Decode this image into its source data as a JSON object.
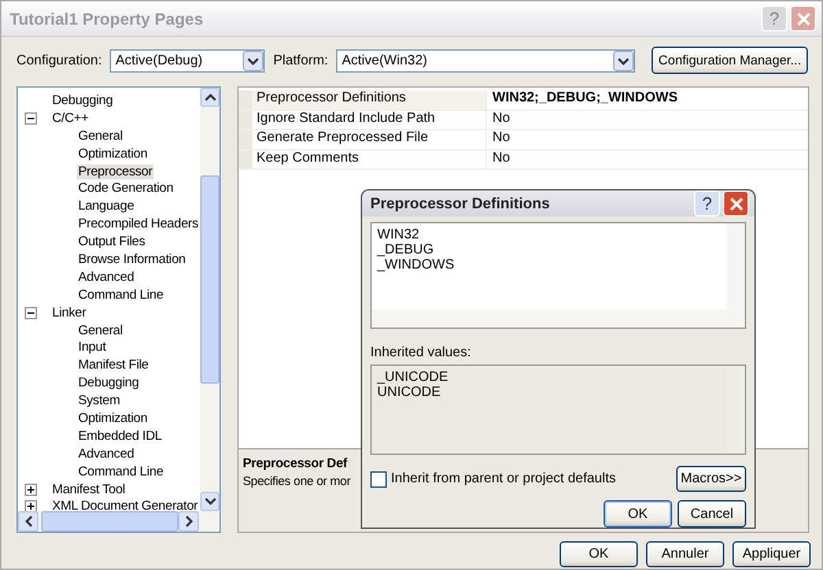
{
  "window": {
    "title": "Tutorial1 Property Pages",
    "help": "?"
  },
  "configuration": {
    "label": "Configuration:",
    "value": "Active(Debug)"
  },
  "platform": {
    "label": "Platform:",
    "value": "Active(Win32)"
  },
  "config_manager_button": "Configuration Manager...",
  "tree": [
    {
      "label": "Debugging",
      "selected": false
    },
    {
      "label": "C/C++",
      "selected": false,
      "expanded": true,
      "children": [
        {
          "label": "General",
          "selected": false
        },
        {
          "label": "Optimization",
          "selected": false
        },
        {
          "label": "Preprocessor",
          "selected": true
        },
        {
          "label": "Code Generation",
          "selected": false
        },
        {
          "label": "Language",
          "selected": false
        },
        {
          "label": "Precompiled Headers",
          "selected": false
        },
        {
          "label": "Output Files",
          "selected": false
        },
        {
          "label": "Browse Information",
          "selected": false
        },
        {
          "label": "Advanced",
          "selected": false
        },
        {
          "label": "Command Line",
          "selected": false
        }
      ]
    },
    {
      "label": "Linker",
      "selected": false,
      "expanded": true,
      "children": [
        {
          "label": "General",
          "selected": false
        },
        {
          "label": "Input",
          "selected": false
        },
        {
          "label": "Manifest File",
          "selected": false
        },
        {
          "label": "Debugging",
          "selected": false
        },
        {
          "label": "System",
          "selected": false
        },
        {
          "label": "Optimization",
          "selected": false
        },
        {
          "label": "Embedded IDL",
          "selected": false
        },
        {
          "label": "Advanced",
          "selected": false
        },
        {
          "label": "Command Line",
          "selected": false
        }
      ]
    },
    {
      "label": "Manifest Tool",
      "selected": false,
      "expanded": false
    },
    {
      "label": "XML Document Generator",
      "selected": false,
      "expanded": false
    }
  ],
  "properties": [
    {
      "name": "Preprocessor Definitions",
      "value": "WIN32;_DEBUG;_WINDOWS",
      "selected": true,
      "modified": true
    },
    {
      "name": "Ignore Standard Include Path",
      "value": "No",
      "selected": false,
      "modified": false
    },
    {
      "name": "Generate Preprocessed File",
      "value": "No",
      "selected": false,
      "modified": false
    },
    {
      "name": "Keep Comments",
      "value": "No",
      "selected": false,
      "modified": false
    }
  ],
  "description": {
    "title": "Preprocessor Def",
    "text": "Specifies one or mor"
  },
  "dialog": {
    "title": "Preprocessor Definitions",
    "help": "?",
    "lines": [
      "WIN32",
      "_DEBUG",
      "_WINDOWS"
    ],
    "inherited_label": "Inherited values:",
    "inherited": [
      "_UNICODE",
      "UNICODE"
    ],
    "checkbox": {
      "label": "Inherit from parent or project defaults",
      "checked": false
    },
    "macros_button": "Macros>>",
    "buttons": [
      "OK",
      "Cancel"
    ]
  },
  "buttons": [
    "OK",
    "Annuler",
    "Appliquer"
  ]
}
